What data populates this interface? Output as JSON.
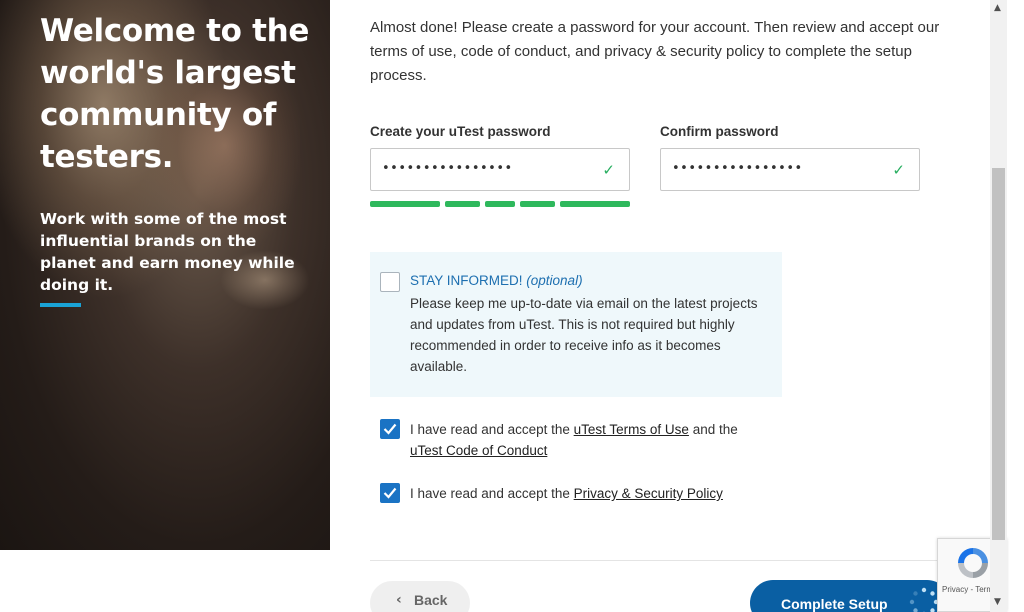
{
  "hero": {
    "title": "Welcome to the world's largest community of testers.",
    "subtitle": "Work with some of the most influential brands on the planet and earn money while doing it."
  },
  "form": {
    "intro": "Almost done! Please create a password for your account. Then review and accept our terms of use, code of conduct, and privacy & security policy to complete the setup process.",
    "password_label": "Create your uTest password",
    "password_value": "••••••••••••••••",
    "confirm_label": "Confirm password",
    "confirm_value": "••••••••••••••••",
    "password_strength": "5/5 segments filled",
    "stay_informed": {
      "title": "STAY INFORMED!",
      "optional": "(optional)",
      "text": "Please keep me up-to-date via email on the latest projects and updates from uTest. This is not required but highly recommended in order to receive info as it becomes available.",
      "checked": false
    },
    "terms": {
      "prefix": "I have read and accept the",
      "terms_link": "uTest Terms of Use",
      "middle": "and the",
      "conduct_link": "uTest Code of Conduct",
      "checked": true
    },
    "privacy": {
      "prefix": "I have read and accept the",
      "privacy_link": "Privacy & Security Policy",
      "checked": true
    },
    "back_label": "Back",
    "complete_label": "Complete Setup"
  },
  "recaptcha": {
    "privacy": "Privacy",
    "separator": "-",
    "terms": "Terms"
  },
  "colors": {
    "accent": "#1aa3d6",
    "checkbox": "#1a73c4",
    "strength": "#2eb85c",
    "primary_button": "#0a5fa3"
  },
  "icons": {
    "check": "check-icon",
    "chevron_left": "chevron-left-icon",
    "spinner": "spinner-icon",
    "recaptcha": "recaptcha-icon"
  }
}
